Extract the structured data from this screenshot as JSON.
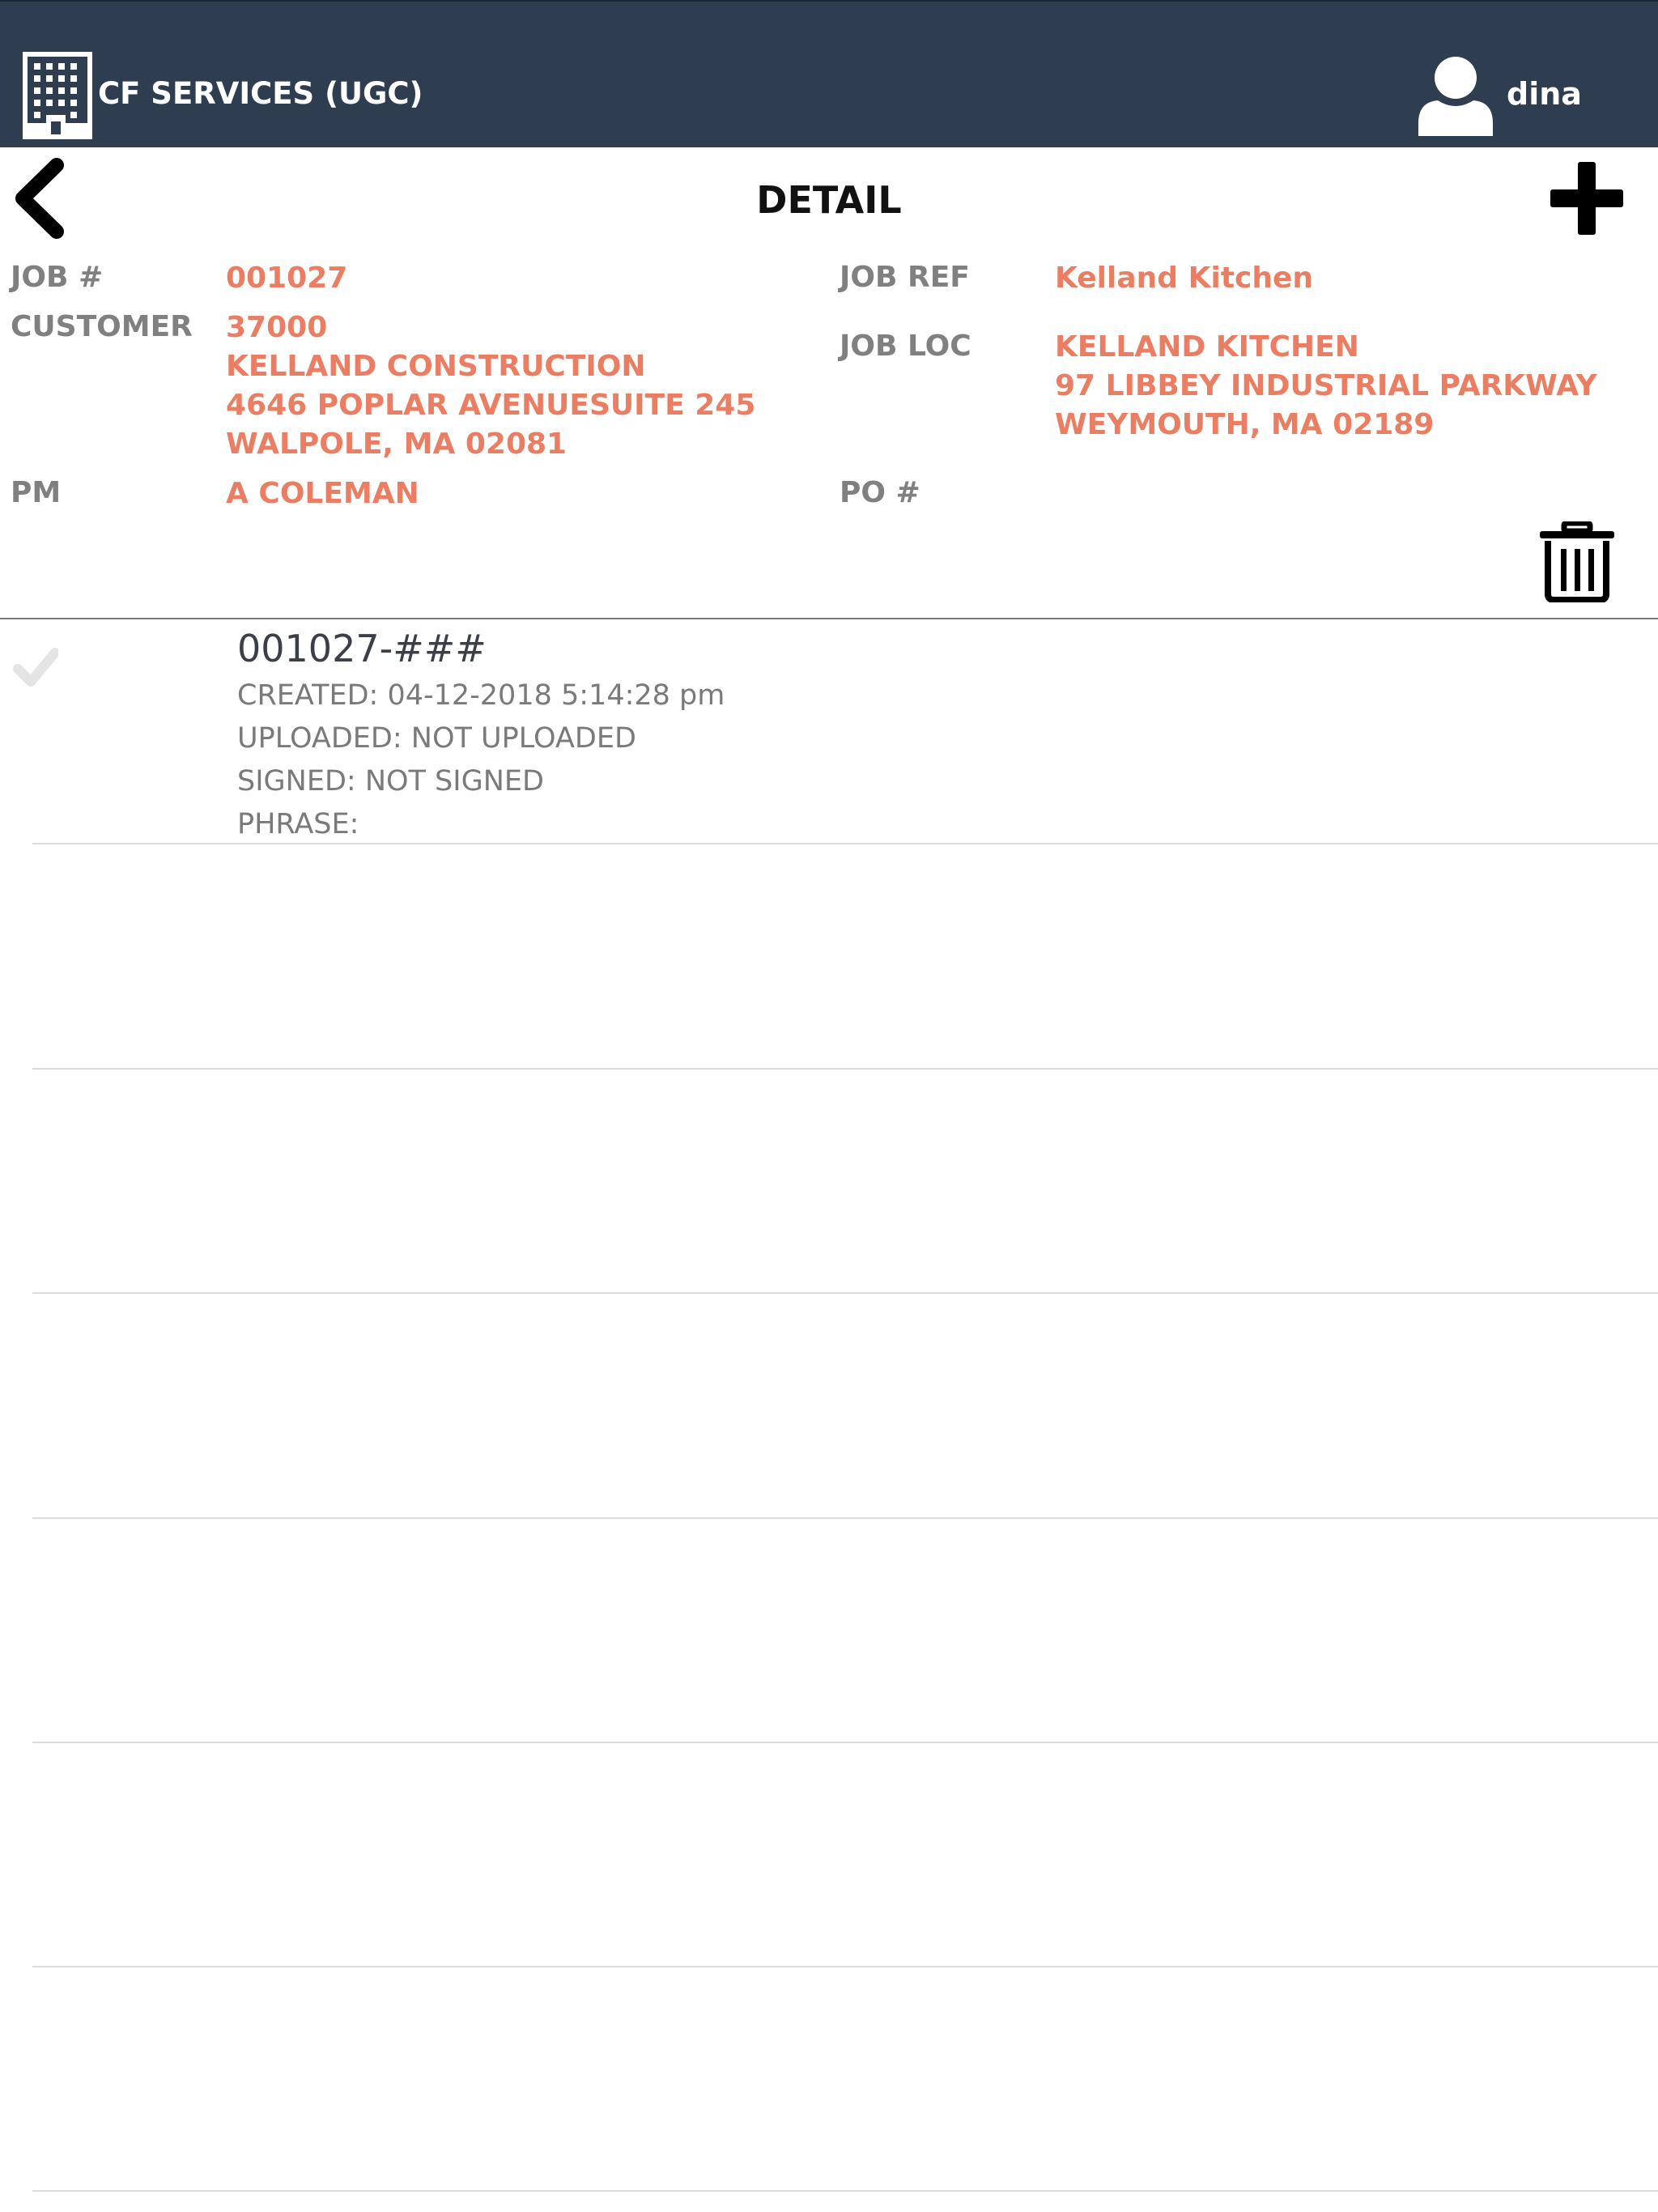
{
  "header": {
    "company_name": "CF SERVICES (UGC)",
    "user_name": "dina",
    "background_color": "#2e3e50"
  },
  "nav": {
    "title": "DETAIL",
    "back_icon": "chevron-left-icon",
    "add_icon": "plus-icon"
  },
  "job": {
    "job_no_label": "JOB #",
    "job_no": "001027",
    "customer_label": "CUSTOMER",
    "customer_lines": [
      "37000",
      "KELLAND CONSTRUCTION",
      "4646 POPLAR AVENUESUITE 245",
      "WALPOLE, MA 02081"
    ],
    "pm_label": "PM",
    "pm": "A COLEMAN",
    "job_ref_label": "JOB REF",
    "job_ref": "Kelland Kitchen",
    "job_loc_label": "JOB LOC",
    "job_loc_lines": [
      "KELLAND KITCHEN",
      "97 LIBBEY INDUSTRIAL PARKWAY",
      "WEYMOUTH, MA 02189"
    ],
    "po_label": "PO #",
    "po": ""
  },
  "documents": [
    {
      "title": "001027-###",
      "created": "CREATED: 04-12-2018 5:14:28 pm",
      "uploaded": "UPLOADED: NOT UPLOADED",
      "signed": "SIGNED: NOT SIGNED",
      "phrase": "PHRASE:"
    }
  ],
  "colors": {
    "accent": "#ea7d62",
    "label": "#808080",
    "header": "#2e3e50"
  }
}
